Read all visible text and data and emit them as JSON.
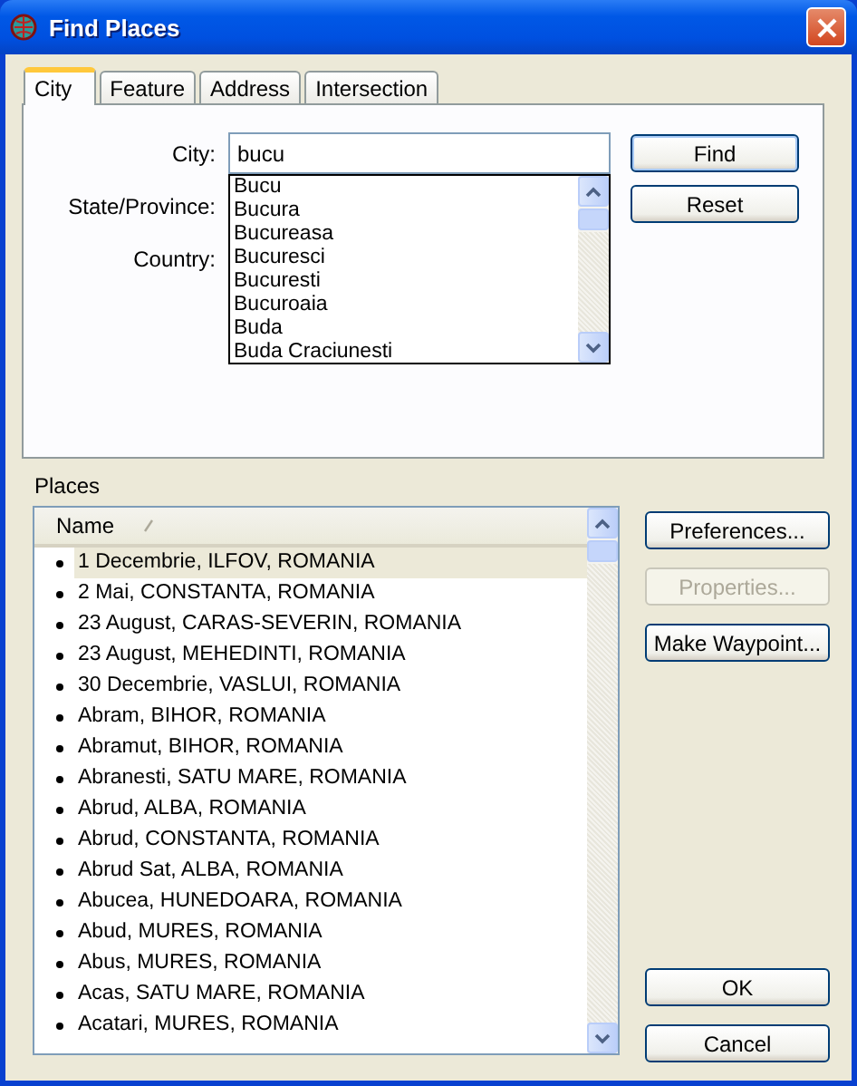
{
  "window": {
    "title": "Find Places"
  },
  "tabs": [
    {
      "label": "City",
      "selected": true
    },
    {
      "label": "Feature",
      "selected": false
    },
    {
      "label": "Address",
      "selected": false
    },
    {
      "label": "Intersection",
      "selected": false
    }
  ],
  "form": {
    "labels": [
      "City:",
      "State/Province:",
      "Country:"
    ],
    "city_value": "bucu",
    "suggestions": [
      "Bucu",
      "Bucura",
      "Bucureasa",
      "Bucuresci",
      "Bucuresti",
      "Bucuroaia",
      "Buda",
      "Buda Craciunesti"
    ]
  },
  "form_buttons": [
    "Find",
    "Reset"
  ],
  "places": {
    "label": "Places",
    "column": "Name",
    "rows": [
      {
        "name": "1 Decembrie, ILFOV, ROMANIA",
        "selected": true
      },
      {
        "name": "2 Mai, CONSTANTA, ROMANIA",
        "selected": false
      },
      {
        "name": "23 August, CARAS-SEVERIN, ROMANIA",
        "selected": false
      },
      {
        "name": "23 August, MEHEDINTI, ROMANIA",
        "selected": false
      },
      {
        "name": "30 Decembrie, VASLUI, ROMANIA",
        "selected": false
      },
      {
        "name": "Abram, BIHOR, ROMANIA",
        "selected": false
      },
      {
        "name": "Abramut, BIHOR, ROMANIA",
        "selected": false
      },
      {
        "name": "Abranesti, SATU MARE, ROMANIA",
        "selected": false
      },
      {
        "name": "Abrud, ALBA, ROMANIA",
        "selected": false
      },
      {
        "name": "Abrud, CONSTANTA, ROMANIA",
        "selected": false
      },
      {
        "name": "Abrud Sat, ALBA, ROMANIA",
        "selected": false
      },
      {
        "name": "Abucea, HUNEDOARA, ROMANIA",
        "selected": false
      },
      {
        "name": "Abud, MURES, ROMANIA",
        "selected": false
      },
      {
        "name": "Abus, MURES, ROMANIA",
        "selected": false
      },
      {
        "name": "Acas, SATU MARE, ROMANIA",
        "selected": false
      },
      {
        "name": "Acatari, MURES, ROMANIA",
        "selected": false
      }
    ]
  },
  "side_buttons": [
    {
      "label": "Preferences...",
      "disabled": false
    },
    {
      "label": "Properties...",
      "disabled": true
    },
    {
      "label": "Make Waypoint...",
      "disabled": false
    }
  ],
  "dialog_buttons": [
    "OK",
    "Cancel"
  ]
}
